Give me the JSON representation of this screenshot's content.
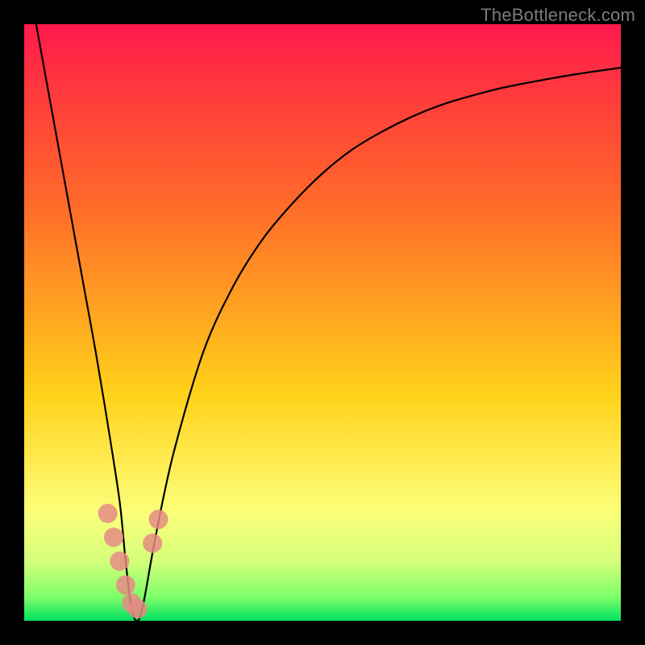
{
  "watermark": "TheBottleneck.com",
  "chart_data": {
    "type": "line",
    "title": "",
    "xlabel": "",
    "ylabel": "",
    "xlim": [
      0,
      100
    ],
    "ylim": [
      0,
      100
    ],
    "series": [
      {
        "name": "bottleneck-curve",
        "x": [
          2,
          4,
          6,
          8,
          10,
          12,
          14,
          16,
          17,
          18,
          19,
          20,
          22,
          25,
          30,
          35,
          40,
          45,
          50,
          55,
          60,
          65,
          70,
          75,
          80,
          85,
          90,
          95,
          100
        ],
        "y": [
          100,
          89,
          78,
          67,
          56,
          45,
          33,
          20,
          10,
          2,
          0,
          3,
          14,
          28,
          45,
          56,
          64,
          70,
          75,
          79,
          82,
          84.5,
          86.5,
          88,
          89.3,
          90.3,
          91.2,
          92,
          92.7
        ]
      }
    ],
    "markers": {
      "name": "salmon-dots",
      "color": "#e58b84",
      "points": [
        {
          "x": 14.0,
          "y": 18.0
        },
        {
          "x": 15.0,
          "y": 14.0
        },
        {
          "x": 16.0,
          "y": 10.0
        },
        {
          "x": 17.0,
          "y": 6.0
        },
        {
          "x": 18.0,
          "y": 3.0
        },
        {
          "x": 19.0,
          "y": 2.0
        },
        {
          "x": 21.5,
          "y": 13.0
        },
        {
          "x": 22.5,
          "y": 17.0
        }
      ]
    }
  }
}
